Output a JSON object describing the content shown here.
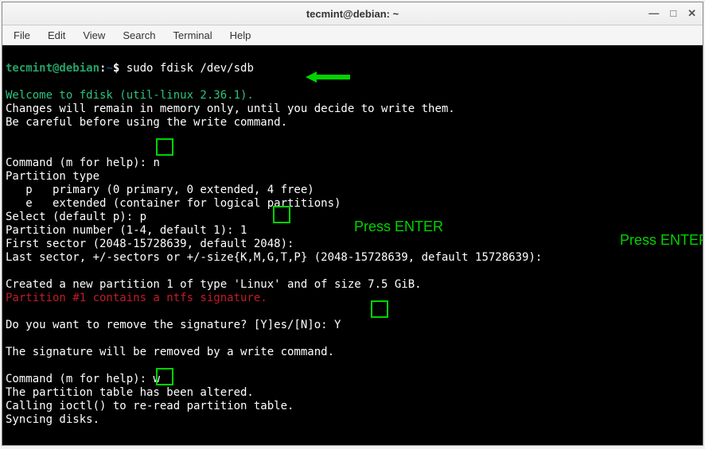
{
  "window": {
    "title": "tecmint@debian: ~",
    "controls": {
      "min": "—",
      "max": "□",
      "close": "✕"
    }
  },
  "menubar": {
    "items": [
      "File",
      "Edit",
      "View",
      "Search",
      "Terminal",
      "Help"
    ]
  },
  "prompt": {
    "user_host": "tecmint@debian",
    "sep": ":",
    "path": "~",
    "sigil": "$ ",
    "command": "sudo fdisk /dev/sdb"
  },
  "terminal_lines": {
    "blank": "",
    "welcome": "Welcome to fdisk (util-linux 2.36.1).",
    "l1": "Changes will remain in memory only, until you decide to write them.",
    "l2": "Be careful before using the write command.",
    "cmd1_pre": "Command (m for help): ",
    "cmd1_in": "n",
    "pt_header": "Partition type",
    "pt_p": "   p   primary (0 primary, 0 extended, 4 free)",
    "pt_e": "   e   extended (container for logical partitions)",
    "select_p": "Select (default p): p",
    "pn_pre": "Partition number (1-4, default 1): ",
    "pn_in": "1",
    "first_sector": "First sector (2048-15728639, default 2048):",
    "last_sector": "Last sector, +/-sectors or +/-size{K,M,G,T,P} (2048-15728639, default 15728639):",
    "created": "Created a new partition 1 of type 'Linux' and of size 7.5 GiB.",
    "ntfs_warn": "Partition #1 contains a ntfs signature.",
    "sig_q_pre": "Do you want to remove the signature? [Y]es/[N]o: ",
    "sig_q_in": "Y",
    "sig_removed": "The signature will be removed by a write command.",
    "cmd2_pre": "Command (m for help): ",
    "cmd2_in": "w",
    "altered": "The partition table has been altered.",
    "ioctl": "Calling ioctl() to re-read partition table.",
    "syncing": "Syncing disks."
  },
  "annotations": {
    "enter1": "Press ENTER",
    "enter2": "Press ENTER"
  }
}
